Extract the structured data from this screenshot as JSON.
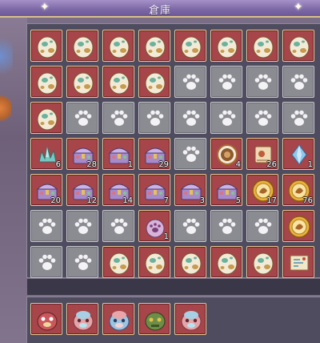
{
  "window": {
    "title": "倉庫"
  },
  "grid": [
    [
      {
        "icon": "egg-icon",
        "qty": ""
      },
      {
        "icon": "egg-icon",
        "qty": ""
      },
      {
        "icon": "egg-icon",
        "qty": ""
      },
      {
        "icon": "egg-icon",
        "qty": ""
      },
      {
        "icon": "egg-icon",
        "qty": ""
      },
      {
        "icon": "egg-icon",
        "qty": ""
      },
      {
        "icon": "egg-icon",
        "qty": ""
      },
      {
        "icon": "egg-icon",
        "qty": ""
      }
    ],
    [
      {
        "icon": "egg-icon",
        "qty": ""
      },
      {
        "icon": "egg-icon",
        "qty": ""
      },
      {
        "icon": "egg-icon",
        "qty": ""
      },
      {
        "icon": "egg-icon",
        "qty": ""
      },
      {
        "icon": "paw-icon",
        "qty": ""
      },
      {
        "icon": "paw-icon",
        "qty": ""
      },
      {
        "icon": "paw-icon",
        "qty": ""
      },
      {
        "icon": "paw-icon",
        "qty": ""
      }
    ],
    [
      {
        "icon": "egg-icon",
        "qty": ""
      },
      {
        "icon": "paw-icon",
        "qty": ""
      },
      {
        "icon": "paw-icon",
        "qty": ""
      },
      {
        "icon": "paw-icon",
        "qty": ""
      },
      {
        "icon": "paw-icon",
        "qty": ""
      },
      {
        "icon": "paw-icon",
        "qty": ""
      },
      {
        "icon": "paw-icon",
        "qty": ""
      },
      {
        "icon": "paw-icon",
        "qty": ""
      }
    ],
    [
      {
        "icon": "crystal-cluster-icon",
        "qty": "6"
      },
      {
        "icon": "treasure-chest-icon",
        "qty": "28"
      },
      {
        "icon": "treasure-chest-icon",
        "qty": "1"
      },
      {
        "icon": "treasure-chest-icon",
        "qty": "29"
      },
      {
        "icon": "paw-icon",
        "qty": ""
      },
      {
        "icon": "bronze-coin-icon",
        "qty": "4"
      },
      {
        "icon": "scroll-icon",
        "qty": "26"
      },
      {
        "icon": "blue-gem-icon",
        "qty": "1"
      }
    ],
    [
      {
        "icon": "treasure-chest-icon",
        "qty": "20"
      },
      {
        "icon": "treasure-chest-icon",
        "qty": "12"
      },
      {
        "icon": "treasure-chest-icon",
        "qty": "14"
      },
      {
        "icon": "treasure-chest-icon",
        "qty": "7"
      },
      {
        "icon": "treasure-chest-icon",
        "qty": "3"
      },
      {
        "icon": "treasure-chest-icon",
        "qty": "5"
      },
      {
        "icon": "gold-coin-icon",
        "qty": "17"
      },
      {
        "icon": "gold-coin-icon",
        "qty": "76"
      }
    ],
    [
      {
        "icon": "paw-icon",
        "qty": ""
      },
      {
        "icon": "paw-icon",
        "qty": ""
      },
      {
        "icon": "paw-icon",
        "qty": ""
      },
      {
        "icon": "paw-bag-icon",
        "qty": "1"
      },
      {
        "icon": "paw-icon",
        "qty": ""
      },
      {
        "icon": "paw-icon",
        "qty": ""
      },
      {
        "icon": "paw-icon",
        "qty": ""
      },
      {
        "icon": "gold-coin-icon",
        "qty": ""
      }
    ],
    [
      {
        "icon": "paw-icon",
        "qty": ""
      },
      {
        "icon": "paw-icon",
        "qty": ""
      },
      {
        "icon": "egg-icon",
        "qty": ""
      },
      {
        "icon": "egg-icon",
        "qty": ""
      },
      {
        "icon": "egg-icon",
        "qty": ""
      },
      {
        "icon": "egg-icon",
        "qty": ""
      },
      {
        "icon": "egg-icon",
        "qty": ""
      },
      {
        "icon": "map-scroll-icon",
        "qty": ""
      }
    ]
  ],
  "pets": [
    {
      "icon": "pet-red-icon"
    },
    {
      "icon": "pet-pink-icon"
    },
    {
      "icon": "pet-blue-icon"
    },
    {
      "icon": "pet-green-icon"
    },
    {
      "icon": "pet-pink-icon"
    }
  ],
  "colors": {
    "slot_red": "#a6454a",
    "slot_grey": "#8b8b92",
    "border_gold": "#e7c993",
    "title_purple": "#7f6aa8"
  }
}
